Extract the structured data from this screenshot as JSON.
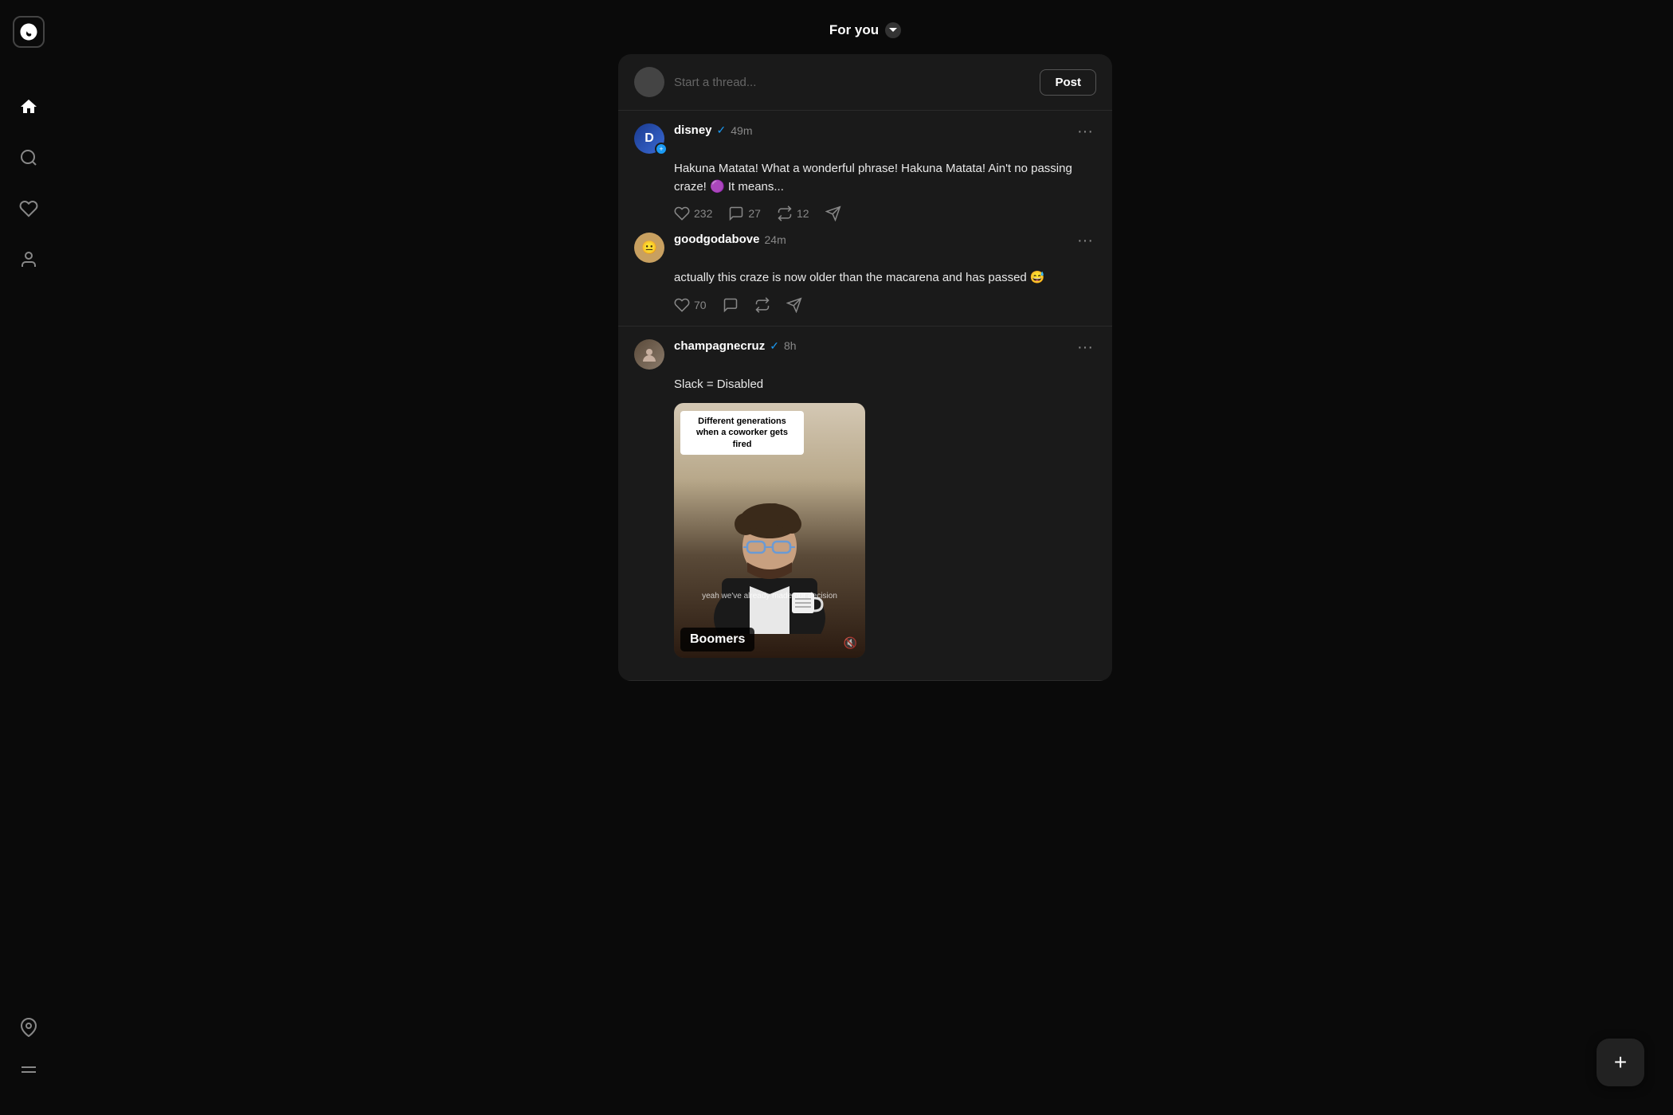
{
  "header": {
    "title": "For you",
    "dropdown_icon": "▾"
  },
  "sidebar": {
    "logo_text": "@",
    "nav_items": [
      {
        "name": "home",
        "label": "Home",
        "active": true
      },
      {
        "name": "search",
        "label": "Search",
        "active": false
      },
      {
        "name": "activity",
        "label": "Activity",
        "active": false
      },
      {
        "name": "profile",
        "label": "Profile",
        "active": false
      }
    ],
    "bottom_items": [
      {
        "name": "pin",
        "label": "Pinned"
      },
      {
        "name": "menu",
        "label": "Menu"
      }
    ]
  },
  "new_thread": {
    "placeholder": "Start a thread...",
    "post_button": "Post"
  },
  "posts": [
    {
      "id": "post1",
      "author": "disney",
      "verified": true,
      "time": "49m",
      "content": "Hakuna Matata! What a wonderful phrase! Hakuna Matata! Ain't no passing craze! 🟣 It means...",
      "likes": "232",
      "comments": "27",
      "reposts": "12",
      "replies": [
        {
          "id": "reply1",
          "author": "goodgodabove",
          "verified": false,
          "time": "24m",
          "content": "actually this craze is now older than the macarena and has passed 😅",
          "likes": "70"
        }
      ]
    },
    {
      "id": "post2",
      "author": "champagnecruz",
      "verified": true,
      "time": "8h",
      "content": "Slack = Disabled",
      "image": {
        "caption_top": "Different generations when a coworker gets fired",
        "caption_bottom": "Boomers",
        "subtitle": "yeah we've already made our decision",
        "mug_text": "Tough Talking"
      }
    }
  ],
  "fab": {
    "label": "+"
  }
}
